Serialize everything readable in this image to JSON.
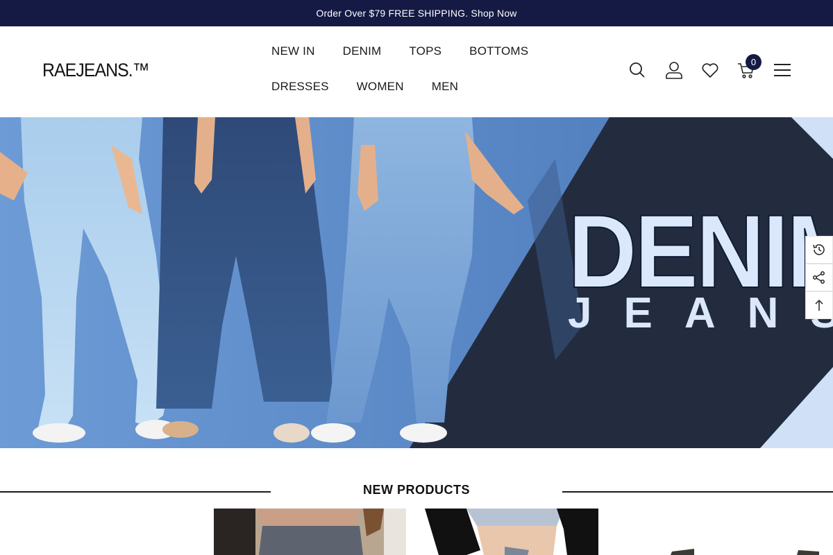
{
  "announcement": {
    "text": "Order Over $79 FREE SHIPPING. Shop Now"
  },
  "header": {
    "logo": "RAEJEANS.™",
    "nav": {
      "row1": [
        "NEW IN",
        "DENIM",
        "TOPS",
        "BOTTOMS"
      ],
      "row2": [
        "DRESSES",
        "WOMEN",
        "MEN"
      ]
    },
    "icons": [
      "search-icon",
      "account-icon",
      "wishlist-icon",
      "cart-icon",
      "menu-icon"
    ],
    "cart_count": "0"
  },
  "hero": {
    "title": "DENIM",
    "subtitle": "JEANS"
  },
  "side_tools": [
    "recently-viewed-icon",
    "share-icon",
    "back-to-top-icon"
  ],
  "section": {
    "title": "NEW PRODUCTS"
  },
  "colors": {
    "brand_navy": "#141a44",
    "hero_blue": "#5b8bc9",
    "hero_dark": "#232c3f",
    "hero_text": "#dbe8fb"
  }
}
